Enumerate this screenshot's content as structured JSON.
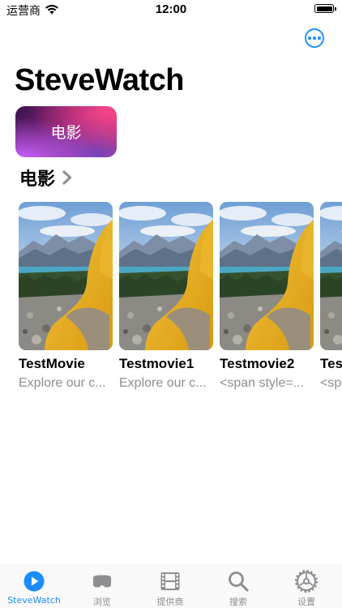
{
  "status_bar": {
    "carrier": "运营商",
    "time": "12:00"
  },
  "header": {
    "title": "SteveWatch"
  },
  "categories": [
    {
      "label": "电影"
    }
  ],
  "section": {
    "title": "电影",
    "movies": [
      {
        "title": "TestMovie",
        "description": "Explore our c..."
      },
      {
        "title": "Testmovie1",
        "description": "Explore our c..."
      },
      {
        "title": "Testmovie2",
        "description": "<span style=..."
      },
      {
        "title": "Tes",
        "description": "<sp"
      }
    ]
  },
  "tab_bar": {
    "items": [
      {
        "label": "SteveWatch",
        "icon": "play-circle-icon",
        "active": true
      },
      {
        "label": "浏览",
        "icon": "vr-headset-icon",
        "active": false
      },
      {
        "label": "提供商",
        "icon": "film-icon",
        "active": false
      },
      {
        "label": "搜索",
        "icon": "search-icon",
        "active": false
      },
      {
        "label": "设置",
        "icon": "gear-icon",
        "active": false
      }
    ],
    "active_color": "#1a8cff",
    "inactive_color": "#8e8e93"
  },
  "colors": {
    "accent": "#1e90ff"
  }
}
